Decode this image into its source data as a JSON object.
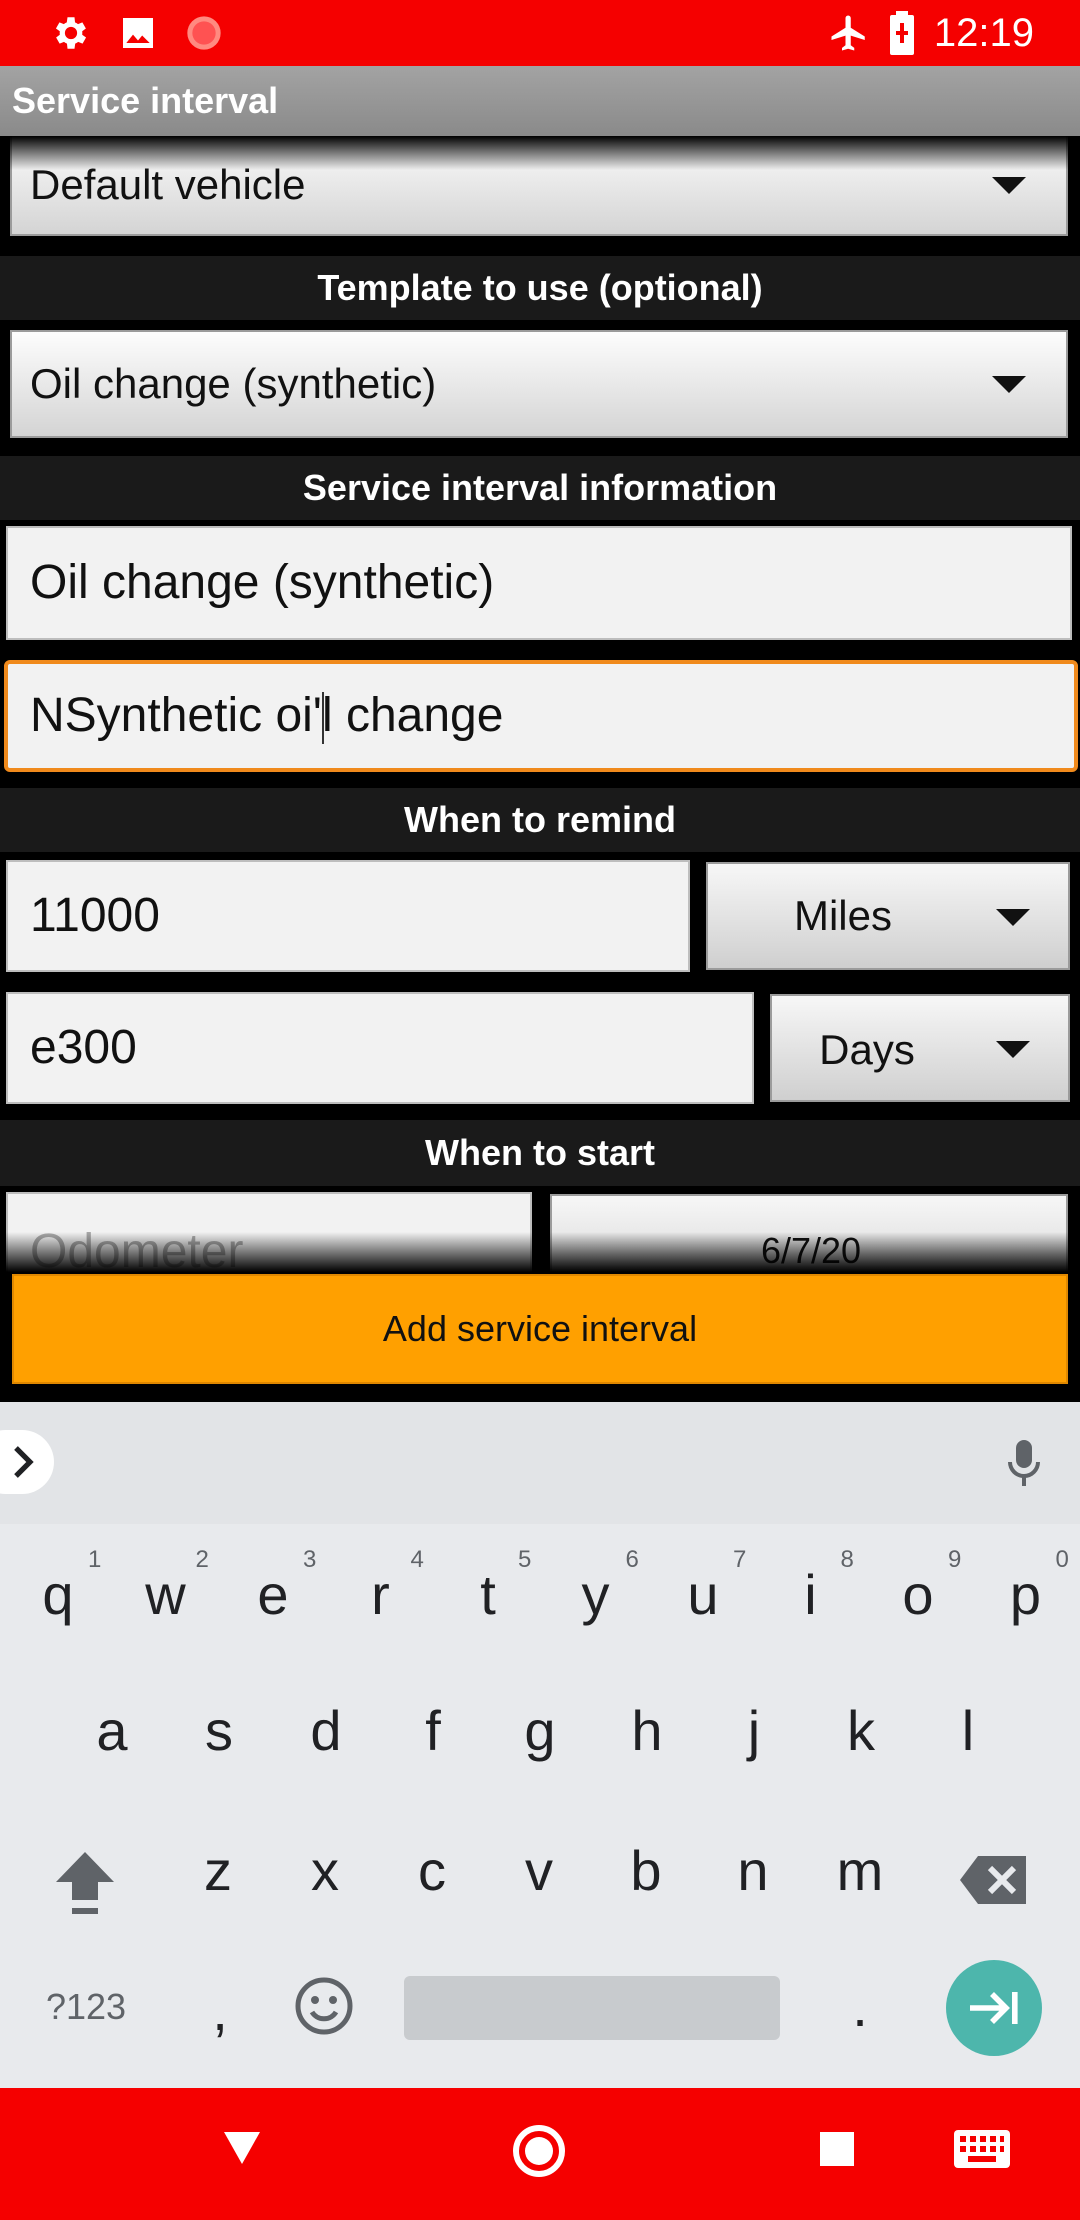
{
  "status_bar": {
    "time": "12:19",
    "left_icons": [
      "gear-icon",
      "image-icon",
      "record-icon"
    ],
    "right_icons": [
      "airplane-icon",
      "battery-charging-icon"
    ],
    "color": "#f50000"
  },
  "title_bar": {
    "title": "Service interval"
  },
  "form": {
    "vehicle_spinner": {
      "value": "Default vehicle"
    },
    "template_header": "Template to use (optional)",
    "template_spinner": {
      "value": "Oil change (synthetic)"
    },
    "info_header": "Service interval information",
    "name_field": {
      "value": "Oil change (synthetic)"
    },
    "description_field": {
      "value": "NSynthetic oi'l change"
    },
    "remind_header": "When to remind",
    "distance_field": {
      "value": "11000"
    },
    "distance_unit": {
      "value": "Miles"
    },
    "time_field": {
      "value": "e300"
    },
    "time_unit": {
      "value": "Days"
    },
    "start_header": "When to start",
    "odometer_field": {
      "placeholder": "Odometer"
    },
    "start_date": {
      "value": "6/7/20"
    }
  },
  "add_button": {
    "label": "Add service interval",
    "color": "#ffa000"
  },
  "keyboard": {
    "row1": [
      {
        "k": "q",
        "n": "1"
      },
      {
        "k": "w",
        "n": "2"
      },
      {
        "k": "e",
        "n": "3"
      },
      {
        "k": "r",
        "n": "4"
      },
      {
        "k": "t",
        "n": "5"
      },
      {
        "k": "y",
        "n": "6"
      },
      {
        "k": "u",
        "n": "7"
      },
      {
        "k": "i",
        "n": "8"
      },
      {
        "k": "o",
        "n": "9"
      },
      {
        "k": "p",
        "n": "0"
      }
    ],
    "row2": [
      "a",
      "s",
      "d",
      "f",
      "g",
      "h",
      "j",
      "k",
      "l"
    ],
    "row3": [
      "z",
      "x",
      "c",
      "v",
      "b",
      "n",
      "m"
    ],
    "symbols_label": "?123",
    "comma": ",",
    "period": ".",
    "action_color": "#4db6ac"
  },
  "nav_bar": {
    "icons": [
      "back-icon",
      "home-icon",
      "recents-icon",
      "keyboard-icon"
    ],
    "color": "#f50000"
  }
}
